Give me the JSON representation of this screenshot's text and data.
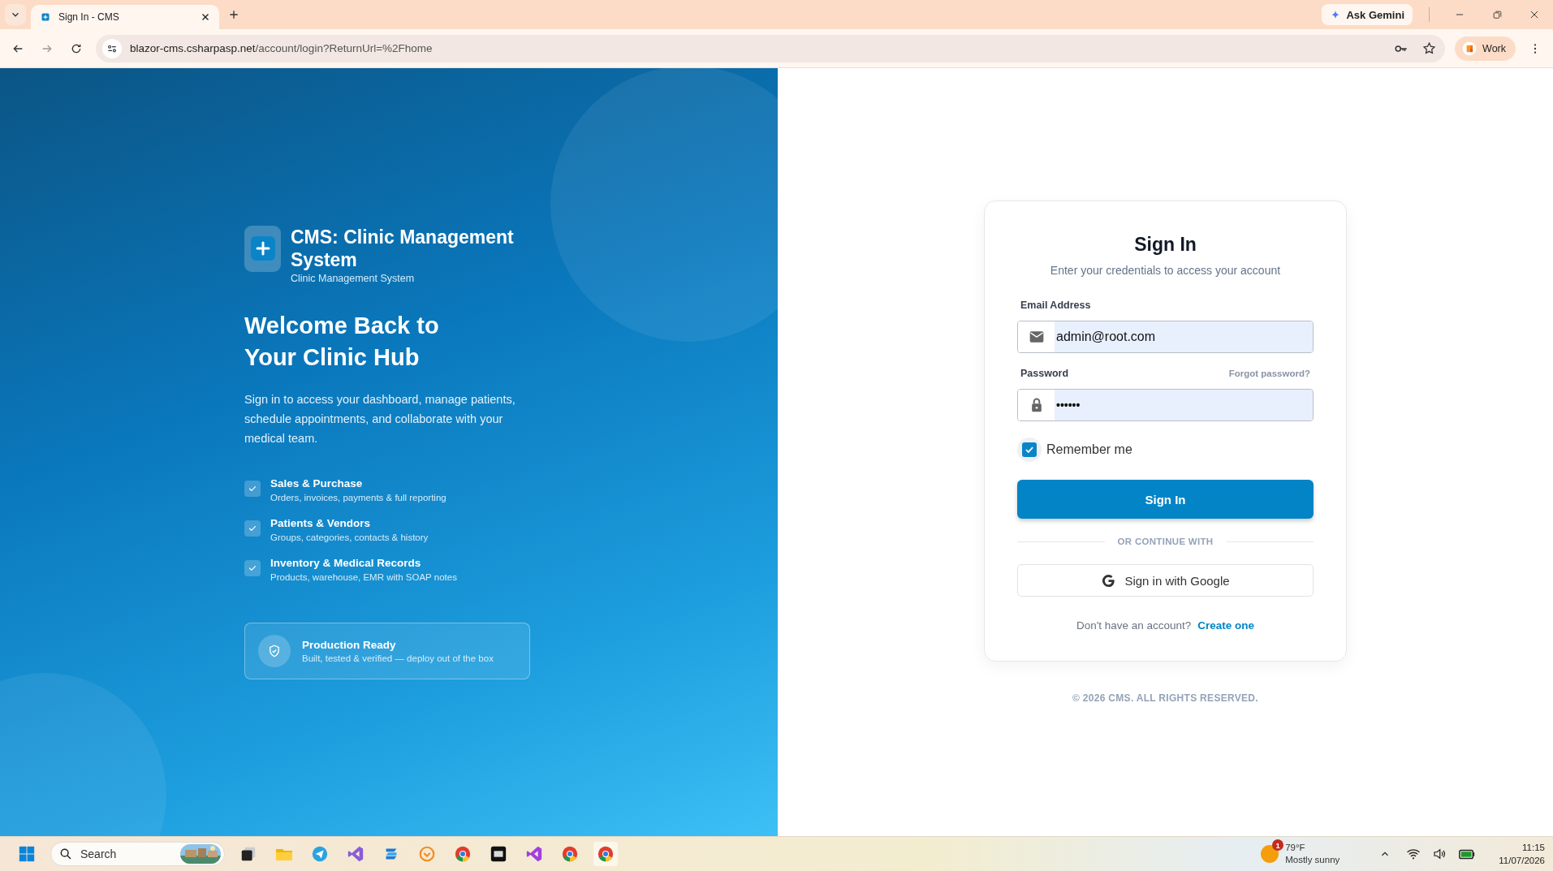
{
  "browser": {
    "tab_title": "Sign In - CMS",
    "url_domain": "blazor-cms.csharpasp.net",
    "url_path": "/account/login?ReturnUrl=%2Fhome",
    "ask_gemini": "Ask Gemini",
    "profile": "Work"
  },
  "hero": {
    "brand_title": "CMS: Clinic Management System",
    "brand_subtitle": "Clinic Management System",
    "heading_lines": [
      "Welcome Back to",
      "Your Clinic Hub"
    ],
    "description": "Sign in to access your dashboard, manage patients, schedule appointments, and collaborate with your medical team.",
    "features": [
      {
        "title": "Sales & Purchase",
        "subtitle": "Orders, invoices, payments & full reporting"
      },
      {
        "title": "Patients & Vendors",
        "subtitle": "Groups, categories, contacts & history"
      },
      {
        "title": "Inventory & Medical Records",
        "subtitle": "Products, warehouse, EMR with SOAP notes"
      }
    ],
    "badge": {
      "title": "Production Ready",
      "text": "Built, tested & verified — deploy out of the box"
    }
  },
  "form": {
    "title": "Sign In",
    "subtitle": "Enter your credentials to access your account",
    "email": {
      "label": "Email Address",
      "value": "admin@root.com"
    },
    "password": {
      "label": "Password",
      "value": "••••••",
      "forgot": "Forgot password?"
    },
    "remember": {
      "label": "Remember me",
      "checked": true
    },
    "submit": "Sign In",
    "divider": "OR CONTINUE WITH",
    "google": "Sign in with Google",
    "signup": {
      "prompt": "Don't have an account?",
      "link": "Create one"
    },
    "copyright": "© 2026 CMS. ALL RIGHTS RESERVED."
  },
  "taskbar": {
    "search": "Search",
    "weather": {
      "temp": "79°F",
      "condition": "Mostly sunny",
      "alert": "1"
    },
    "time": "11:15",
    "date": "11/07/2026"
  }
}
